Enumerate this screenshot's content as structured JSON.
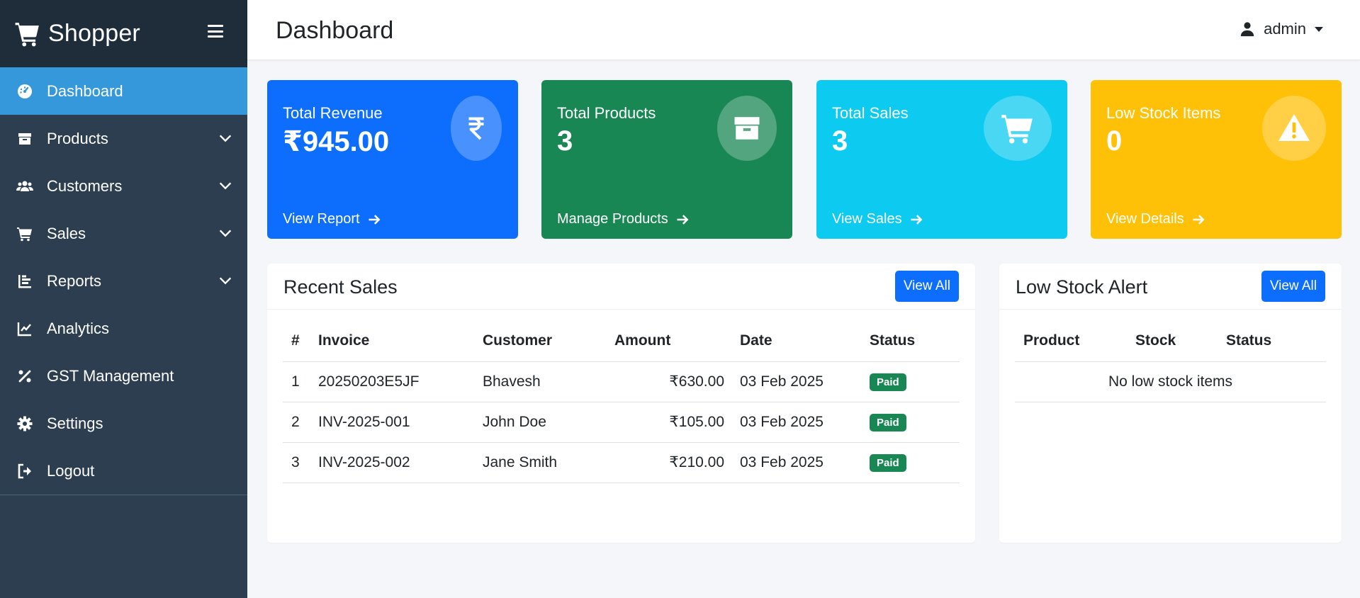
{
  "app": {
    "name": "Shopper"
  },
  "sidebar": {
    "items": [
      {
        "label": "Dashboard",
        "icon": "dashboard-gauge-icon",
        "active": true
      },
      {
        "label": "Products",
        "icon": "box-icon",
        "expandable": true
      },
      {
        "label": "Customers",
        "icon": "users-icon",
        "expandable": true
      },
      {
        "label": "Sales",
        "icon": "cart-icon",
        "expandable": true
      },
      {
        "label": "Reports",
        "icon": "bar-chart-icon",
        "expandable": true
      },
      {
        "label": "Analytics",
        "icon": "line-chart-icon"
      },
      {
        "label": "GST Management",
        "icon": "percent-icon"
      },
      {
        "label": "Settings",
        "icon": "gear-icon"
      },
      {
        "label": "Logout",
        "icon": "logout-icon"
      }
    ]
  },
  "header": {
    "title": "Dashboard",
    "user": "admin"
  },
  "cards": [
    {
      "label": "Total Revenue",
      "value": "₹945.00",
      "link": "View Report",
      "icon": "rupee-icon",
      "color": "#0d6efd"
    },
    {
      "label": "Total Products",
      "value": "3",
      "link": "Manage Products",
      "icon": "box-icon",
      "color": "#198754"
    },
    {
      "label": "Total Sales",
      "value": "3",
      "link": "View Sales",
      "icon": "cart-icon",
      "color": "#0dcaf0"
    },
    {
      "label": "Low Stock Items",
      "value": "0",
      "link": "View Details",
      "icon": "warning-icon",
      "color": "#ffc107"
    }
  ],
  "recent_sales": {
    "title": "Recent Sales",
    "button": "View All",
    "columns": [
      "#",
      "Invoice",
      "Customer",
      "Amount",
      "Date",
      "Status"
    ],
    "rows": [
      {
        "num": "1",
        "invoice": "20250203E5JF",
        "customer": "Bhavesh",
        "amount": "₹630.00",
        "date": "03 Feb 2025",
        "status": "Paid"
      },
      {
        "num": "2",
        "invoice": "INV-2025-001",
        "customer": "John Doe",
        "amount": "₹105.00",
        "date": "03 Feb 2025",
        "status": "Paid"
      },
      {
        "num": "3",
        "invoice": "INV-2025-002",
        "customer": "Jane Smith",
        "amount": "₹210.00",
        "date": "03 Feb 2025",
        "status": "Paid"
      }
    ]
  },
  "low_stock": {
    "title": "Low Stock Alert",
    "button": "View All",
    "columns": [
      "Product",
      "Stock",
      "Status"
    ],
    "empty": "No low stock items"
  }
}
